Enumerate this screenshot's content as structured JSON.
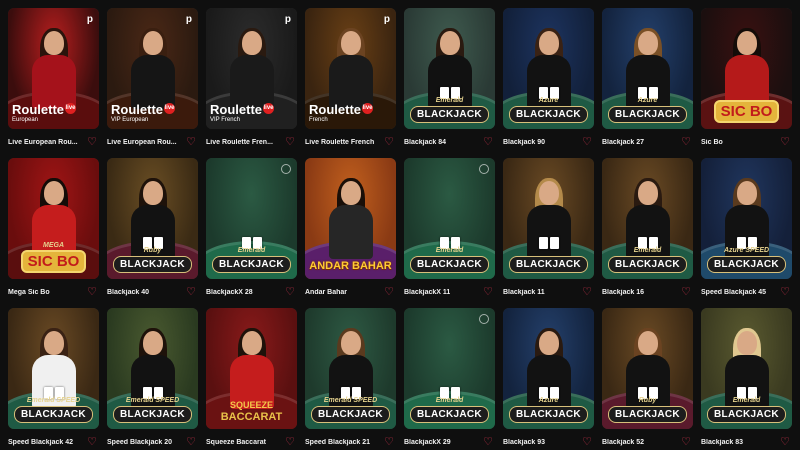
{
  "games": [
    {
      "title": "Live European Rou...",
      "logo": "Roulette",
      "sub": "European",
      "kind": "roulette",
      "badge": "p",
      "bg": "#3b0d0d",
      "accent": "#b81e1e",
      "felt": "#5a0d0d",
      "hair": "#2a140c",
      "dress": "#a5121b"
    },
    {
      "title": "Live European Rou...",
      "logo": "Roulette",
      "sub": "VIP European",
      "kind": "roulette",
      "badge": "p",
      "bg": "#2b1a10",
      "accent": "#4b2816",
      "felt": "#3b1a0c",
      "hair": "#3a1f10",
      "dress": "#151515"
    },
    {
      "title": "Live Roulette Fren...",
      "logo": "Roulette",
      "sub": "VIP French",
      "kind": "roulette",
      "badge": "p",
      "bg": "#1a1a1a",
      "accent": "#2c2c2c",
      "felt": "#202020",
      "hair": "#2a1a10",
      "dress": "#1a1a1a"
    },
    {
      "title": "Live Roulette French",
      "logo": "Roulette",
      "sub": "French",
      "kind": "roulette",
      "badge": "p",
      "bg": "#3a2410",
      "accent": "#6a4015",
      "felt": "#2a1808",
      "hair": "#6b4321",
      "dress": "#1a1a1a"
    },
    {
      "title": "Blackjack 84",
      "logo": "BLACKJACK",
      "sub": "Emerald",
      "kind": "bj",
      "bg": "#2a3a35",
      "accent": "#3f5b4f",
      "felt": "#1f5a44",
      "hair": "#2a1a10",
      "dress": "#111111"
    },
    {
      "title": "Blackjack 90",
      "logo": "BLACKJACK",
      "sub": "Azure",
      "kind": "bj",
      "bg": "#12203a",
      "accent": "#1d3460",
      "felt": "#1f5a44",
      "hair": "#3a2214",
      "dress": "#121212"
    },
    {
      "title": "Blackjack 27",
      "logo": "BLACKJACK",
      "sub": "Azure",
      "kind": "bj",
      "bg": "#13233e",
      "accent": "#24406b",
      "felt": "#1f5a44",
      "hair": "#7a5026",
      "dress": "#121212"
    },
    {
      "title": "Sic Bo",
      "logo": "SIC BO",
      "sub": "",
      "kind": "sic",
      "bg": "#1b0f0f",
      "accent": "#3a1010",
      "felt": "#5a1212",
      "hair": "#140c08",
      "dress": "#b51a1a"
    },
    {
      "title": "Mega Sic Bo",
      "logo": "SIC BO",
      "sub": "MEGA",
      "kind": "sic",
      "bg": "#6a0d0d",
      "accent": "#a11515",
      "felt": "#5a0e0e",
      "hair": "#140c08",
      "dress": "#c51d1d"
    },
    {
      "title": "Blackjack 40",
      "logo": "BLACKJACK",
      "sub": "Ruby",
      "kind": "bj",
      "bg": "#3a2a14",
      "accent": "#6a4e24",
      "felt": "#5a1a2c",
      "hair": "#1e120a",
      "dress": "#121212"
    },
    {
      "title": "BlackjackX 28",
      "logo": "BLACKJACK",
      "sub": "Emerald",
      "kind": "bjx",
      "bg": "#1c3a2c",
      "accent": "#2b5a43",
      "felt": "#1f6a4a",
      "hair": "",
      "dress": ""
    },
    {
      "title": "Andar Bahar",
      "logo": "ANDAR BAHAR",
      "sub": "",
      "kind": "andar",
      "bg": "#8a3a14",
      "accent": "#c2601e",
      "felt": "#5a1f6a",
      "hair": "#1a0f08",
      "dress": "#262626"
    },
    {
      "title": "BlackjackX 11",
      "logo": "BLACKJACK",
      "sub": "Emerald",
      "kind": "bjx",
      "bg": "#1c3a2c",
      "accent": "#2b5a43",
      "felt": "#1f6a4a",
      "hair": "",
      "dress": ""
    },
    {
      "title": "Blackjack 11",
      "logo": "BLACKJACK",
      "sub": "",
      "kind": "bj",
      "bg": "#3a2814",
      "accent": "#6a4a24",
      "felt": "#1f5a44",
      "hair": "#b48a4a",
      "dress": "#121212"
    },
    {
      "title": "Blackjack 16",
      "logo": "BLACKJACK",
      "sub": "Emerald",
      "kind": "bj",
      "bg": "#3a2814",
      "accent": "#6a4a24",
      "felt": "#1f5a44",
      "hair": "#2a1a10",
      "dress": "#121212"
    },
    {
      "title": "Speed Blackjack 45",
      "logo": "BLACKJACK",
      "sub": "Azure SPEED",
      "kind": "bj",
      "bg": "#14203a",
      "accent": "#20365e",
      "felt": "#1f4a6a",
      "hair": "#5a3a1e",
      "dress": "#121212"
    },
    {
      "title": "Speed Blackjack 42",
      "logo": "BLACKJACK",
      "sub": "Emerald SPEED",
      "kind": "bj",
      "bg": "#3a2814",
      "accent": "#6a4a24",
      "felt": "#1f5a44",
      "hair": "#3a2214",
      "dress": "#f0f0f0"
    },
    {
      "title": "Speed Blackjack 20",
      "logo": "BLACKJACK",
      "sub": "Emerald SPEED",
      "kind": "bj",
      "bg": "#2a3a20",
      "accent": "#4a5a30",
      "felt": "#1f5a44",
      "hair": "#1e120a",
      "dress": "#121212"
    },
    {
      "title": "Squeeze Baccarat",
      "logo": "SQUEEZE",
      "sub": "BACCARAT",
      "kind": "squeeze",
      "bg": "#5a1010",
      "accent": "#8a1a1a",
      "felt": "#6a1212",
      "hair": "#1e120a",
      "dress": "#c51d1d"
    },
    {
      "title": "Speed Blackjack 21",
      "logo": "BLACKJACK",
      "sub": "Emerald SPEED",
      "kind": "bj",
      "bg": "#1e3a2c",
      "accent": "#2e5a44",
      "felt": "#1f5a44",
      "hair": "#5a3a1e",
      "dress": "#121212"
    },
    {
      "title": "BlackjackX 29",
      "logo": "BLACKJACK",
      "sub": "Emerald",
      "kind": "bjx",
      "bg": "#1c3a2c",
      "accent": "#2b5a43",
      "felt": "#1f6a4a",
      "hair": "",
      "dress": ""
    },
    {
      "title": "Blackjack 93",
      "logo": "BLACKJACK",
      "sub": "Azure",
      "kind": "bj",
      "bg": "#13233e",
      "accent": "#24406b",
      "felt": "#1f5a44",
      "hair": "#2a1a10",
      "dress": "#121212"
    },
    {
      "title": "Blackjack 52",
      "logo": "BLACKJACK",
      "sub": "Ruby",
      "kind": "bj",
      "bg": "#3a2814",
      "accent": "#6a4a24",
      "felt": "#5a1a2c",
      "hair": "#6b4321",
      "dress": "#121212"
    },
    {
      "title": "Blackjack 83",
      "logo": "BLACKJACK",
      "sub": "Emerald",
      "kind": "bj",
      "bg": "#3a3a20",
      "accent": "#5a5a30",
      "felt": "#1f5a44",
      "hair": "#e0c890",
      "dress": "#121212"
    }
  ]
}
